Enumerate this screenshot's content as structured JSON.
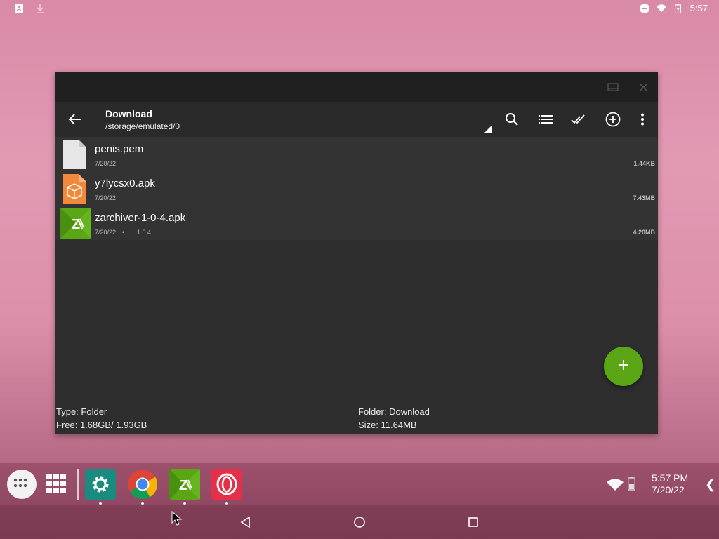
{
  "status_bar": {
    "time": "5:57",
    "left_icons": [
      "text-a-icon",
      "download-icon"
    ],
    "right_icons": [
      "do-not-disturb-icon",
      "wifi-icon",
      "battery-icon"
    ]
  },
  "window": {
    "title_buttons": [
      "minimize-icon",
      "close-icon"
    ],
    "toolbar": {
      "title": "Download",
      "path": "/storage/emulated/0",
      "actions": [
        "search-icon",
        "list-view-icon",
        "select-all-icon",
        "add-circle-icon",
        "more-vert-icon"
      ]
    },
    "files": [
      {
        "name": "penis.pem",
        "date": "7/20/22",
        "meta": "",
        "version": "",
        "size": "1.44KB",
        "icon": "document-file-icon"
      },
      {
        "name": "y7lycsx0.apk",
        "date": "7/20/22",
        "meta": "",
        "version": "",
        "size": "7.43MB",
        "icon": "apk-package-icon"
      },
      {
        "name": "zarchiver-1-0-4.apk",
        "date": "7/20/22",
        "meta": "•",
        "version": "1.0.4",
        "size": "4.20MB",
        "icon": "zarchiver-icon"
      }
    ],
    "fab_icon": "plus-icon",
    "footer": {
      "type": "Type: Folder",
      "free": "Free: 1.68GB/ 1.93GB",
      "folder": "Folder: Download",
      "size": "Size: 11.64MB"
    }
  },
  "taskbar": {
    "apps": [
      {
        "name": "Settings",
        "icon": "settings-gear-icon",
        "color": "#1a8c7f"
      },
      {
        "name": "Chrome",
        "icon": "chrome-icon",
        "color": "#ffffff"
      },
      {
        "name": "ZArchiver",
        "icon": "zarchiver-icon",
        "color": "#5aa614"
      },
      {
        "name": "Opera",
        "icon": "opera-icon",
        "color": "#e5304a"
      }
    ],
    "tray_time": "5:57 PM",
    "tray_date": "7/20/22",
    "tray_icons": [
      "wifi-icon",
      "battery-icon"
    ]
  },
  "colors": {
    "accent_green": "#5aa614",
    "window_bg": "#2e2e2e",
    "title_bar": "#202020"
  }
}
